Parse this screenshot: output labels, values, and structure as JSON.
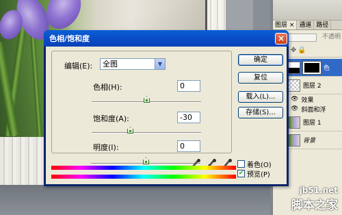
{
  "dialog": {
    "title": "色相/饱和度",
    "edit": {
      "label": "编辑(E):",
      "selected": "全图"
    },
    "sliders": [
      {
        "label": "色相(H):",
        "value": "0",
        "position": 0.5
      },
      {
        "label": "饱和度(A):",
        "value": "-30",
        "position": 0.35
      },
      {
        "label": "明度(I):",
        "value": "0",
        "position": 0.5
      }
    ],
    "buttons": {
      "ok": "确定",
      "reset": "复位",
      "load": "载入(L)...",
      "save": "存储(S)..."
    },
    "checkboxes": {
      "colorize": {
        "label": "着色(O)",
        "checked": false
      },
      "preview": {
        "label": "预览(P)",
        "checked": true
      }
    },
    "close_symbol": "×"
  },
  "layers_panel": {
    "tabs": [
      "图层 ×",
      "通道",
      "路径"
    ],
    "blend_label": "",
    "opacity_label": "不透明",
    "layers": [
      {
        "name": "色",
        "type": "adjustment",
        "selected": true
      },
      {
        "name": "图层 2",
        "type": "layer"
      },
      {
        "name": "效果",
        "type": "effects"
      },
      {
        "name": "斜面和浮",
        "type": "effect"
      },
      {
        "name": "图层 1",
        "type": "layer"
      },
      {
        "name": "背景",
        "type": "background"
      }
    ]
  },
  "watermark": {
    "url": "jb51.net",
    "name": "脚本之家"
  },
  "colors": {
    "title_bar": "#0a4fc9",
    "dialog_bg": "#ece9d8",
    "selected_layer": "#3169c6",
    "slider_thumb": "#2c9a2c"
  }
}
